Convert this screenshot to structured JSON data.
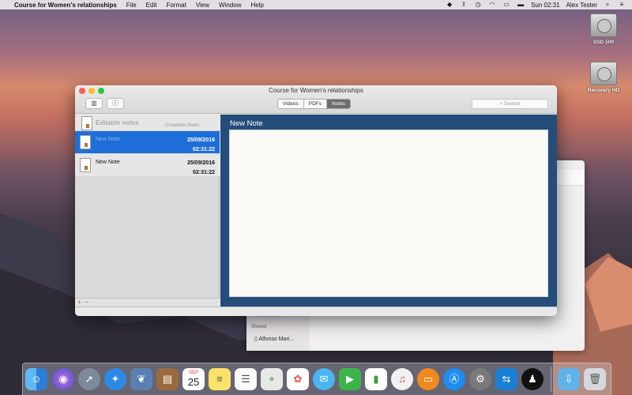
{
  "menubar": {
    "app_name": "Course for Women's relationships",
    "menus": [
      "File",
      "Edit",
      "Format",
      "View",
      "Window",
      "Help"
    ],
    "clock": "Sun 02:31",
    "user": "Alex Tester"
  },
  "desktop": {
    "drives": [
      {
        "label": "SSD 500"
      },
      {
        "label": "Recovery HD"
      }
    ]
  },
  "background_window": {
    "faded_item": "Remote Disc",
    "section_header": "Shared",
    "shared_item": "Alfonso Mari..."
  },
  "window": {
    "title": "Course for Women's relationships",
    "tabs": [
      {
        "label": "Videos",
        "selected": false
      },
      {
        "label": "PDFs",
        "selected": false
      },
      {
        "label": "Notes",
        "selected": true
      }
    ],
    "search_placeholder": "Search",
    "list_header": {
      "title": "Editable notes",
      "date_col": "Creation Date:"
    },
    "notes": [
      {
        "name": "New Note",
        "date": "25/09/2016",
        "time": "02:31:22",
        "selected": true
      },
      {
        "name": "New Note",
        "date": "25/09/2016",
        "time": "02:31:22",
        "selected": false
      }
    ],
    "footer_add": "+",
    "footer_remove": "−",
    "note_title": "New Note",
    "note_body": ""
  },
  "dock": {
    "calendar_month": "SEP",
    "calendar_day": "25"
  },
  "colors": {
    "selection_blue": "#1e6ed8",
    "editor_bg": "#244d7a",
    "segment_selected": "#6d6d6d"
  }
}
